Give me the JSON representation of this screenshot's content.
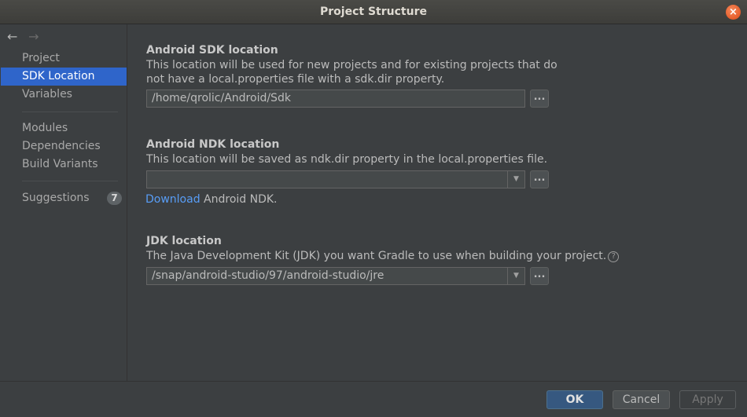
{
  "window": {
    "title": "Project Structure",
    "close_symbol": "×"
  },
  "nav": {
    "back": "←",
    "forward": "→"
  },
  "sidebar": {
    "items": [
      {
        "label": "Project"
      },
      {
        "label": "SDK Location"
      },
      {
        "label": "Variables"
      },
      {
        "label": "Modules"
      },
      {
        "label": "Dependencies"
      },
      {
        "label": "Build Variants"
      },
      {
        "label": "Suggestions",
        "badge": "7"
      }
    ],
    "selected": "SDK Location"
  },
  "sdk": {
    "heading": "Android SDK location",
    "desc_line1": "This location will be used for new projects and for existing projects that do",
    "desc_line2": "not have a local.properties file with a sdk.dir property.",
    "path": "/home/qrolic/Android/Sdk",
    "browse": "..."
  },
  "ndk": {
    "heading": "Android NDK location",
    "desc": "This location will be saved as ndk.dir property in the local.properties file.",
    "path": "",
    "browse": "...",
    "download_link": "Download",
    "download_rest": " Android NDK."
  },
  "jdk": {
    "heading": "JDK location",
    "desc": "The Java Development Kit (JDK) you want Gradle to use when building your project.",
    "help": "?",
    "path": "/snap/android-studio/97/android-studio/jre",
    "browse": "..."
  },
  "footer": {
    "ok": "OK",
    "cancel": "Cancel",
    "apply": "Apply"
  },
  "colors": {
    "accent": "#2f65ca",
    "link": "#589df6",
    "ok_button": "#365880",
    "background": "#3c3f41"
  },
  "icons": {
    "back": "arrow-left-icon",
    "forward": "arrow-right-icon",
    "dropdown": "chevron-down-icon",
    "help": "help-icon",
    "close": "close-icon"
  }
}
